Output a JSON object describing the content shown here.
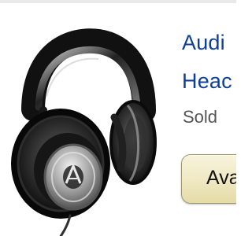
{
  "product": {
    "title_line_1": "Audi",
    "title_line_2": "Heac",
    "sold_by": "Sold",
    "image": {
      "icon": "headphones-icon",
      "brand_mark": "audio-technica-logo"
    }
  },
  "actions": {
    "availability_button_label": "Ava"
  },
  "colors": {
    "link": "#0d3f98",
    "secondary_text": "#555555",
    "button_fill": "#efe8c2",
    "button_border": "#9a9a72"
  }
}
